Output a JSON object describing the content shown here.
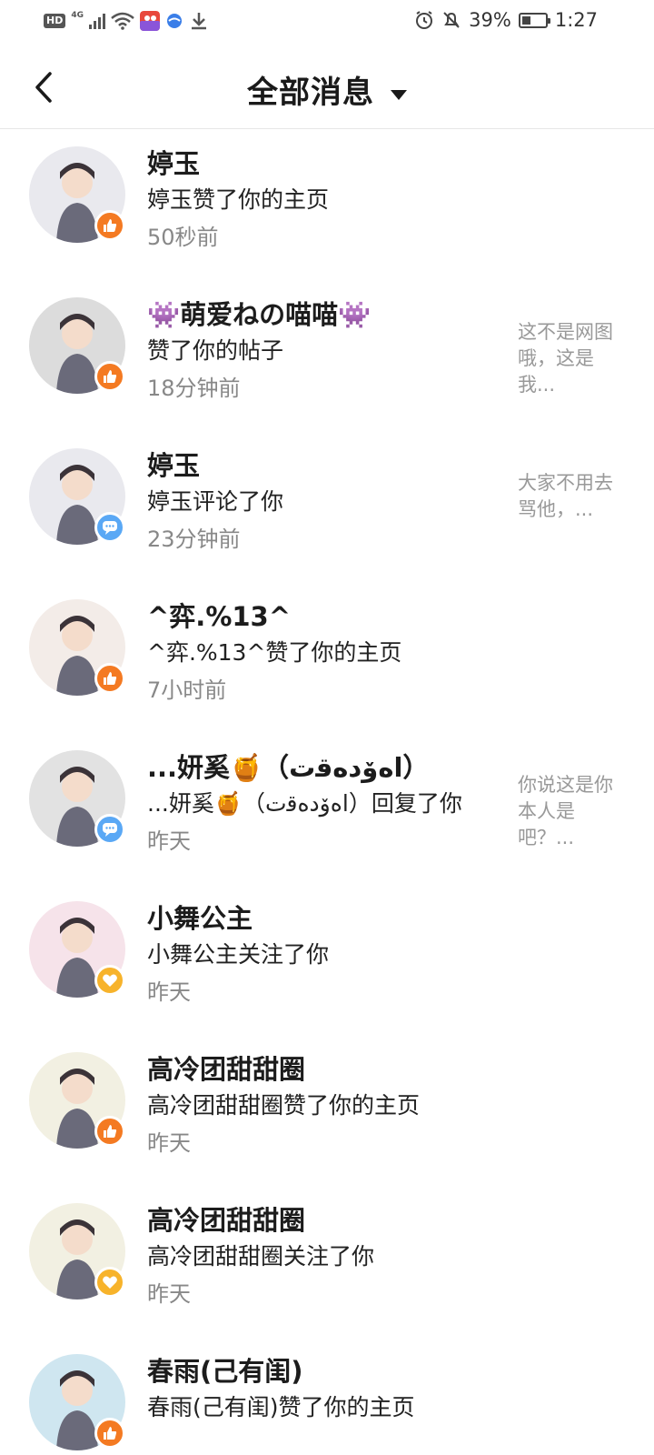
{
  "status_bar": {
    "hd": "HD",
    "network": "4G",
    "battery": "39%",
    "battery_level": 0.39,
    "time": "1:27"
  },
  "header": {
    "title": "全部消息"
  },
  "messages": [
    {
      "name": "婷玉",
      "action": "婷玉赞了你的主页",
      "time": "50秒前",
      "snippet": "",
      "type": "like",
      "avatar_color": "#e9e9ee"
    },
    {
      "name": "👾萌爱ねの喵喵👾",
      "action": "赞了你的帖子",
      "time": "18分钟前",
      "snippet": "这不是网图哦，这是我...",
      "type": "like",
      "avatar_color": "#dcdcdc"
    },
    {
      "name": "婷玉",
      "action": "婷玉评论了你",
      "time": "23分钟前",
      "snippet": "大家不用去骂他，...",
      "type": "comment",
      "avatar_color": "#e9e9ee"
    },
    {
      "name": "^弈.%13^",
      "action": "^弈.%13^赞了你的主页",
      "time": "7小时前",
      "snippet": "",
      "type": "like",
      "avatar_color": "#f3ece8"
    },
    {
      "name": "...妍奚🍯（ﺍﻩۆﺩﻩﻗﺕ）",
      "action": "...妍奚🍯（ﺍﻩۆﺩﻩﻗﺕ）回复了你",
      "time": "昨天",
      "snippet": "你说这是你本人是吧？...",
      "type": "comment",
      "avatar_color": "#e2e2e2"
    },
    {
      "name": "小舞公主",
      "action": "小舞公主关注了你",
      "time": "昨天",
      "snippet": "",
      "type": "follow",
      "avatar_color": "#f6e3ea"
    },
    {
      "name": "高冷团甜甜圈",
      "action": "高冷团甜甜圈赞了你的主页",
      "time": "昨天",
      "snippet": "",
      "type": "like",
      "avatar_color": "#f2f0e2"
    },
    {
      "name": "高冷团甜甜圈",
      "action": "高冷团甜甜圈关注了你",
      "time": "昨天",
      "snippet": "",
      "type": "follow",
      "avatar_color": "#f2f0e2"
    },
    {
      "name": "春雨(己有闺)",
      "action": "春雨(己有闺)赞了你的主页",
      "time": "",
      "snippet": "",
      "type": "like",
      "avatar_color": "#cfe6f0"
    }
  ]
}
